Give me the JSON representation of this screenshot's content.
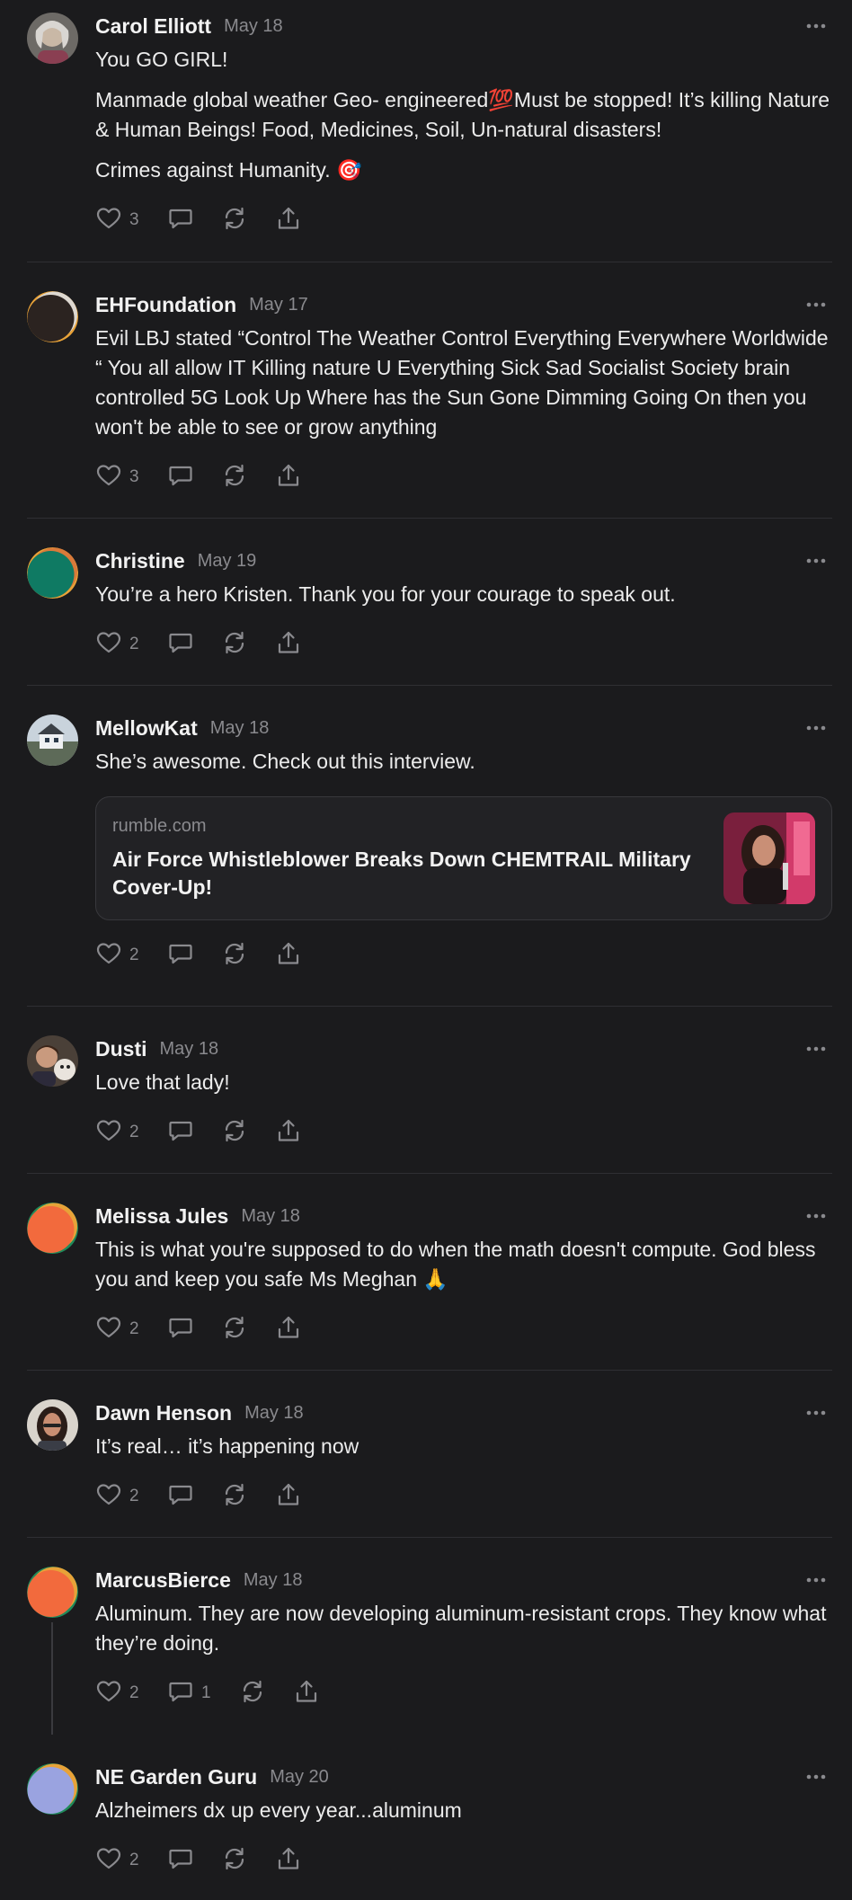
{
  "comments": [
    {
      "author": "Carol Elliott",
      "date": "May 18",
      "paragraphs": [
        "You GO GIRL!",
        "Manmade global weather Geo- engineered💯Must be stopped! It’s killing Nature & Human Beings! Food, Medicines, Soil, Un-natural disasters!",
        "Crimes against Humanity. 🎯"
      ],
      "likes": "3",
      "replies": ""
    },
    {
      "author": "EHFoundation",
      "date": "May 17",
      "paragraphs": [
        "Evil LBJ stated “Control The Weather Control Everything Everywhere Worldwide “ You all allow IT Killing nature U Everything Sick Sad Socialist Society brain controlled 5G Look Up Where has the Sun Gone Dimming Going On then you won't be able to see or grow anything"
      ],
      "likes": "3",
      "replies": ""
    },
    {
      "author": "Christine",
      "date": "May 19",
      "paragraphs": [
        "You’re a hero Kristen. Thank you for your courage to speak out."
      ],
      "likes": "2",
      "replies": ""
    },
    {
      "author": "MellowKat",
      "date": "May 18",
      "paragraphs": [
        "She’s awesome. Check out this interview."
      ],
      "link": {
        "domain": "rumble.com",
        "title": "Air Force Whistleblower Breaks Down CHEMTRAIL Military Cover-Up!"
      },
      "likes": "2",
      "replies": ""
    },
    {
      "author": "Dusti",
      "date": "May 18",
      "paragraphs": [
        "Love that lady!"
      ],
      "likes": "2",
      "replies": ""
    },
    {
      "author": "Melissa Jules",
      "date": "May 18",
      "paragraphs": [
        "This is what you're supposed to do when the math doesn't compute. God bless you and keep you safe Ms Meghan 🙏"
      ],
      "likes": "2",
      "replies": ""
    },
    {
      "author": "Dawn Henson",
      "date": "May 18",
      "paragraphs": [
        "It’s real… it’s happening now"
      ],
      "likes": "2",
      "replies": ""
    },
    {
      "author": "MarcusBierce",
      "date": "May 18",
      "paragraphs": [
        "Aluminum. They are now developing aluminum-resistant crops. They know what they’re doing."
      ],
      "likes": "2",
      "replies": "1"
    },
    {
      "author": "NE Garden Guru",
      "date": "May 20",
      "paragraphs": [
        "Alzheimers dx up every year...aluminum"
      ],
      "likes": "2",
      "replies": ""
    }
  ],
  "colors": {
    "background": "#1b1b1d",
    "text": "#ececec",
    "muted": "#8a8a8e",
    "divider": "#2f2f33"
  },
  "icons": {
    "like": "heart-icon",
    "reply": "comment-bubble-icon",
    "restack": "restack-icon",
    "share": "share-icon",
    "more": "more-dots-icon"
  }
}
